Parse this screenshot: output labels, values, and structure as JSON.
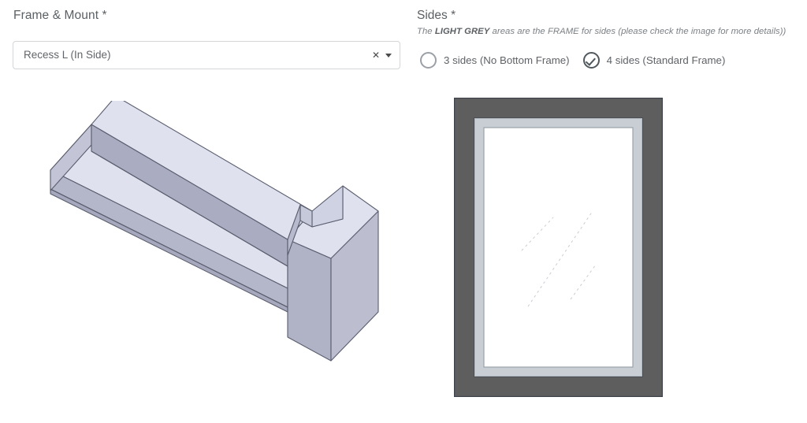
{
  "left_panel": {
    "label": "Frame & Mount *",
    "select": {
      "name": "frame-mount-select",
      "value": "Recess L (In Side)",
      "clear_icon": "close-x-icon",
      "caret_icon": "chevron-down-icon",
      "options": [
        "Recess L (In Side)"
      ]
    },
    "illustration": {
      "name": "recess-l-3d-diagram",
      "alt": "Recess L (In Side) isometric profile",
      "colors": {
        "top_face": "#dfe2ee",
        "front_face": "#a9abc0",
        "side_face": "#b8bacd",
        "outline": "#5a5d6e"
      }
    }
  },
  "right_panel": {
    "label": "Sides *",
    "hint_prefix": "The ",
    "hint_bold": "LIGHT GREY",
    "hint_suffix": " areas are the FRAME for sides (please check the image for more details))",
    "options": [
      {
        "label": "3 sides (No Bottom Frame)",
        "checked": false
      },
      {
        "label": "4 sides (Standard Frame)",
        "checked": true
      }
    ],
    "frame_image": {
      "name": "frame-4-sides-preview",
      "colors": {
        "outer_frame": "#5e5e5e",
        "outer_edge": "#3b3f47",
        "light_grey_band": "#c9ced4",
        "inner_mat": "#ffffff",
        "inner_line": "#9aa3ab"
      }
    }
  },
  "theme": {
    "accent": "#50585e",
    "text": "#5f6368",
    "border": "#d4d6d8",
    "background": "#ffffff"
  }
}
